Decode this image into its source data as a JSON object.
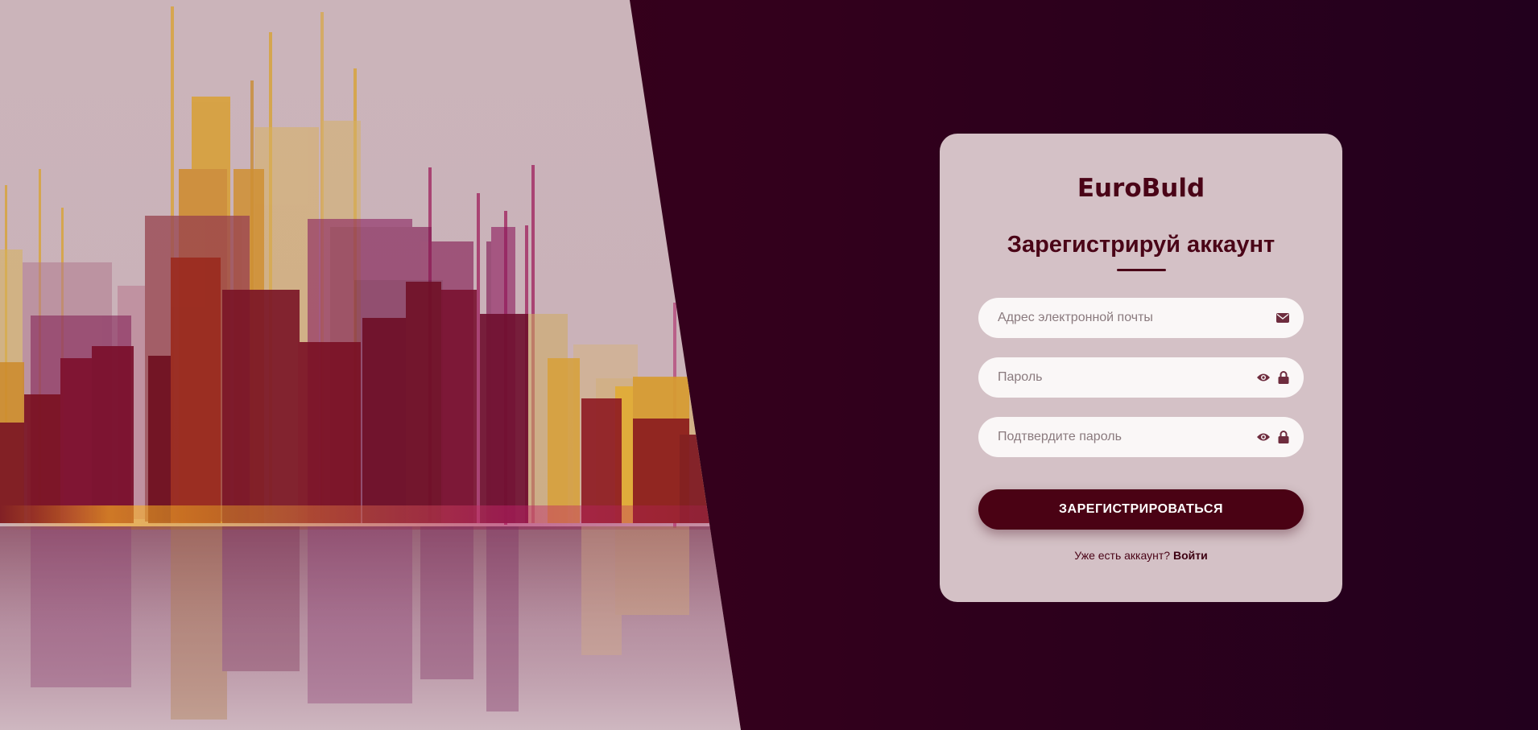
{
  "brand": {
    "name": "EuroBuld"
  },
  "form": {
    "title": "Зарегистрируй аккаунт",
    "email": {
      "placeholder": "Адрес электронной почты",
      "value": "",
      "icon": "envelope-icon"
    },
    "password": {
      "placeholder": "Пароль",
      "value": "",
      "icons": [
        "eye-icon",
        "lock-icon"
      ]
    },
    "confirm_password": {
      "placeholder": "Подтвердите пароль",
      "value": "",
      "icons": [
        "eye-icon",
        "lock-icon"
      ]
    },
    "submit_label": "ЗАРЕГИСТРИРОВАТЬСЯ"
  },
  "footer": {
    "prompt": "Уже есть аккаунт?",
    "login_link": "Войти"
  },
  "colors": {
    "accent": "#4a0214",
    "card_bg": "#d4c1c6",
    "page_bg_left": "#3d0018",
    "page_bg_right": "#22001d"
  }
}
